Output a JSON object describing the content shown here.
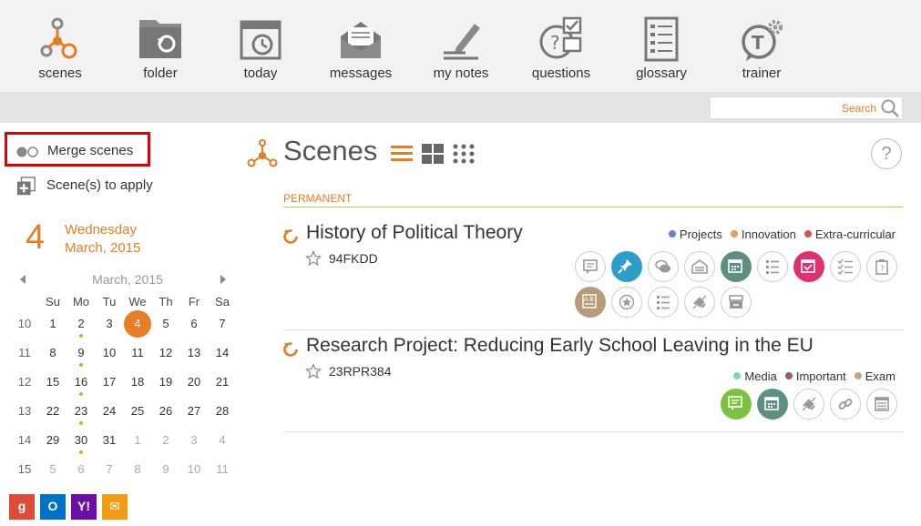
{
  "toolbar": {
    "items": [
      {
        "label": "scenes",
        "icon": "scenes-icon"
      },
      {
        "label": "folder",
        "icon": "folder-icon"
      },
      {
        "label": "today",
        "icon": "calendar-clock-icon"
      },
      {
        "label": "messages",
        "icon": "envelope-icon"
      },
      {
        "label": "my notes",
        "icon": "pencil-note-icon"
      },
      {
        "label": "questions",
        "icon": "question-check-icon"
      },
      {
        "label": "glossary",
        "icon": "glossary-list-icon"
      },
      {
        "label": "trainer",
        "icon": "trainer-gear-icon"
      }
    ]
  },
  "search": {
    "label": "Search"
  },
  "sidebar": {
    "merge_label": "Merge scenes",
    "apply_label": "Scene(s) to apply",
    "current_day_number": "4",
    "current_weekday": "Wednesday",
    "current_month_year": "March, 2015",
    "calendar": {
      "month_label": "March, 2015",
      "weekday_headers": [
        "Su",
        "Mo",
        "Tu",
        "We",
        "Th",
        "Fr",
        "Sa"
      ],
      "weeks": [
        {
          "week": "10",
          "days": [
            "1",
            "2",
            "3",
            "4",
            "5",
            "6",
            "7"
          ]
        },
        {
          "week": "11",
          "days": [
            "8",
            "9",
            "10",
            "11",
            "12",
            "13",
            "14"
          ]
        },
        {
          "week": "12",
          "days": [
            "15",
            "16",
            "17",
            "18",
            "19",
            "20",
            "21"
          ]
        },
        {
          "week": "13",
          "days": [
            "22",
            "23",
            "24",
            "25",
            "26",
            "27",
            "28"
          ]
        },
        {
          "week": "14",
          "days": [
            "29",
            "30",
            "31",
            "1",
            "2",
            "3",
            "4"
          ]
        },
        {
          "week": "15",
          "days": [
            "5",
            "6",
            "7",
            "8",
            "9",
            "10",
            "11"
          ]
        }
      ],
      "selected_day": "4",
      "marked_days": [
        "2",
        "9",
        "16",
        "23",
        "30"
      ]
    },
    "share": [
      {
        "name": "google-share-icon",
        "label": "g",
        "color": "#dd4b39"
      },
      {
        "name": "outlook-share-icon",
        "label": "O",
        "color": "#0072c6"
      },
      {
        "name": "yahoo-share-icon",
        "label": "Y!",
        "color": "#6b0ea8"
      },
      {
        "name": "email-share-icon",
        "label": "✉",
        "color": "#f39c12"
      }
    ]
  },
  "main": {
    "title": "Scenes",
    "section_label": "PERMANENT",
    "help_label": "?",
    "scenes": [
      {
        "title": "History of Political Theory",
        "code": "94FKDD",
        "tags": [
          {
            "label": "Projects",
            "color": "#6a7fd1"
          },
          {
            "label": "Innovation",
            "color": "#f0965a"
          },
          {
            "label": "Extra-curricular",
            "color": "#d9534f"
          }
        ],
        "tools": [
          {
            "name": "comment-note-tool",
            "fill": ""
          },
          {
            "name": "pin-tool",
            "fill": "#2e9ec9"
          },
          {
            "name": "chat-tool",
            "fill": ""
          },
          {
            "name": "inbox-tool",
            "fill": ""
          },
          {
            "name": "calendar-tool",
            "fill": "#5f8f82"
          },
          {
            "name": "list-tool",
            "fill": ""
          },
          {
            "name": "calendar-check-tool",
            "fill": "#e0306e"
          },
          {
            "name": "checklist-tool",
            "fill": ""
          },
          {
            "name": "clipboard-question-tool",
            "fill": ""
          },
          {
            "name": "ab-glossary-tool",
            "fill": "#b79a78"
          },
          {
            "name": "star-badge-tool",
            "fill": ""
          },
          {
            "name": "list-tool-2",
            "fill": ""
          },
          {
            "name": "link-off-tool",
            "fill": ""
          },
          {
            "name": "archive-tool",
            "fill": ""
          }
        ]
      },
      {
        "title": "Research Project: Reducing Early School Leaving in the EU",
        "code": "23RPR384",
        "tags": [
          {
            "label": "Media",
            "color": "#7fd6b9"
          },
          {
            "label": "Important",
            "color": "#9a5a6a"
          },
          {
            "label": "Exam",
            "color": "#c8a57d"
          }
        ],
        "tools": [
          {
            "name": "comment-note-tool",
            "fill": "#7cc241"
          },
          {
            "name": "calendar-tool",
            "fill": "#5f8f82"
          },
          {
            "name": "link-off-tool",
            "fill": ""
          },
          {
            "name": "link-tool",
            "fill": ""
          },
          {
            "name": "table-tool",
            "fill": ""
          }
        ]
      }
    ]
  },
  "colors": {
    "accent": "#e67e22",
    "highlight_border": "#e00000"
  }
}
